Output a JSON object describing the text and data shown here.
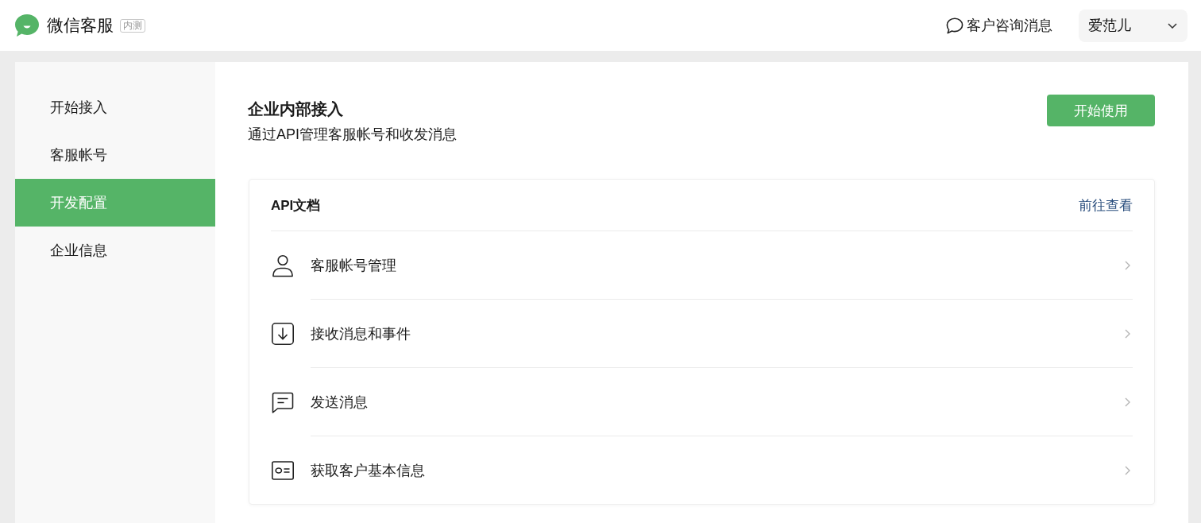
{
  "header": {
    "app_name": "微信客服",
    "badge": "内测",
    "consult_link": "客户咨询消息",
    "user": "爱范儿"
  },
  "sidebar": {
    "items": [
      {
        "label": "开始接入",
        "selected": false
      },
      {
        "label": "客服帐号",
        "selected": false
      },
      {
        "label": "开发配置",
        "selected": true
      },
      {
        "label": "企业信息",
        "selected": false
      }
    ]
  },
  "content": {
    "title": "企业内部接入",
    "subtitle": "通过API管理客服帐号和收发消息",
    "button": "开始使用",
    "api_docs": {
      "title": "API文档",
      "link": "前往查看",
      "items": [
        {
          "kind": "person",
          "label": "客服帐号管理"
        },
        {
          "kind": "download",
          "label": "接收消息和事件"
        },
        {
          "kind": "message",
          "label": "发送消息"
        },
        {
          "kind": "card",
          "label": "获取客户基本信息"
        }
      ]
    }
  }
}
